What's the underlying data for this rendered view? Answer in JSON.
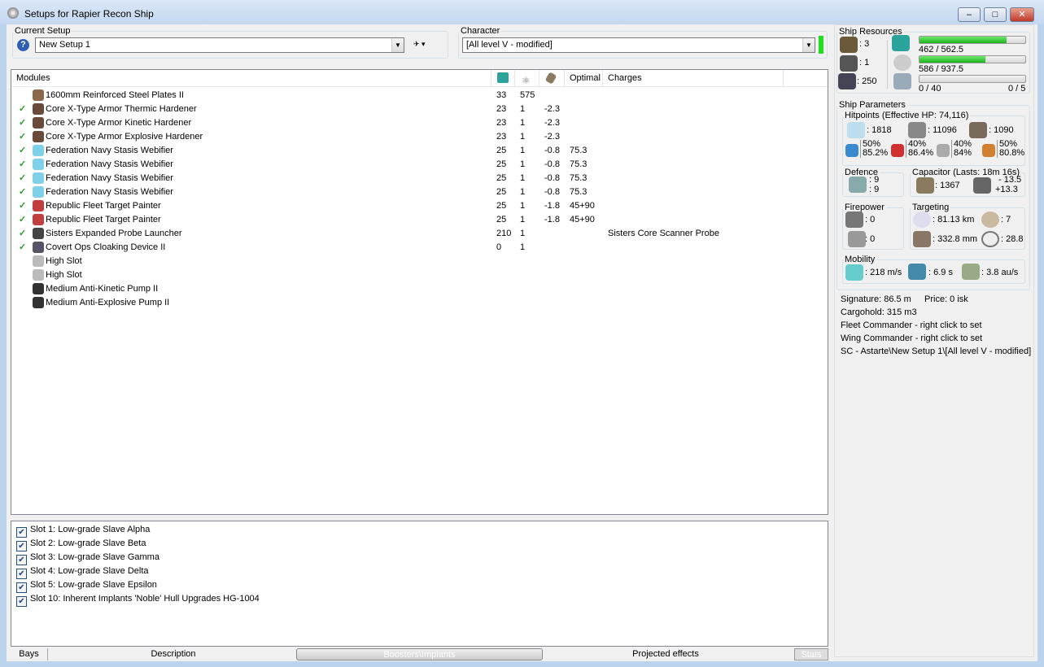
{
  "window": {
    "title": "Setups for Rapier Recon Ship",
    "min": "–",
    "max": "□",
    "close": "✕"
  },
  "current_setup": {
    "label": "Current Setup",
    "value": "New Setup 1"
  },
  "character": {
    "label": "Character",
    "value": "[All level V - modified]",
    "status_color": "#22dd22"
  },
  "modules": {
    "headers": [
      "Modules",
      "",
      "",
      "",
      "Optimal",
      "Charges"
    ],
    "rows": [
      {
        "check": "",
        "name": "1600mm Reinforced Steel Plates II",
        "c1": "33",
        "c2": "575",
        "c3": "",
        "optimal": "",
        "charges": "",
        "color": "#8a6a4a"
      },
      {
        "check": "✓",
        "name": "Core X-Type Armor Thermic Hardener",
        "c1": "23",
        "c2": "1",
        "c3": "-2.3",
        "optimal": "",
        "charges": "",
        "color": "#6a4a3a"
      },
      {
        "check": "✓",
        "name": "Core X-Type Armor Kinetic Hardener",
        "c1": "23",
        "c2": "1",
        "c3": "-2.3",
        "optimal": "",
        "charges": "",
        "color": "#6a4a3a"
      },
      {
        "check": "✓",
        "name": "Core X-Type Armor Explosive Hardener",
        "c1": "23",
        "c2": "1",
        "c3": "-2.3",
        "optimal": "",
        "charges": "",
        "color": "#6a4a3a"
      },
      {
        "check": "✓",
        "name": "Federation Navy Stasis Webifier",
        "c1": "25",
        "c2": "1",
        "c3": "-0.8",
        "optimal": "75.3",
        "charges": "",
        "color": "#7fd0e8"
      },
      {
        "check": "✓",
        "name": "Federation Navy Stasis Webifier",
        "c1": "25",
        "c2": "1",
        "c3": "-0.8",
        "optimal": "75.3",
        "charges": "",
        "color": "#7fd0e8"
      },
      {
        "check": "✓",
        "name": "Federation Navy Stasis Webifier",
        "c1": "25",
        "c2": "1",
        "c3": "-0.8",
        "optimal": "75.3",
        "charges": "",
        "color": "#7fd0e8"
      },
      {
        "check": "✓",
        "name": "Federation Navy Stasis Webifier",
        "c1": "25",
        "c2": "1",
        "c3": "-0.8",
        "optimal": "75.3",
        "charges": "",
        "color": "#7fd0e8"
      },
      {
        "check": "✓",
        "name": "Republic Fleet Target Painter",
        "c1": "25",
        "c2": "1",
        "c3": "-1.8",
        "optimal": "45+90",
        "charges": "",
        "color": "#c04040"
      },
      {
        "check": "✓",
        "name": "Republic Fleet Target Painter",
        "c1": "25",
        "c2": "1",
        "c3": "-1.8",
        "optimal": "45+90",
        "charges": "",
        "color": "#c04040"
      },
      {
        "check": "✓",
        "name": "Sisters Expanded Probe Launcher",
        "c1": "210",
        "c2": "1",
        "c3": "",
        "optimal": "",
        "charges": "Sisters Core Scanner Probe",
        "color": "#444"
      },
      {
        "check": "✓",
        "name": "Covert Ops Cloaking Device II",
        "c1": "0",
        "c2": "1",
        "c3": "",
        "optimal": "",
        "charges": "",
        "color": "#556"
      },
      {
        "check": "",
        "name": "High Slot",
        "c1": "",
        "c2": "",
        "c3": "",
        "optimal": "",
        "charges": "",
        "color": "#bbb"
      },
      {
        "check": "",
        "name": "High Slot",
        "c1": "",
        "c2": "",
        "c3": "",
        "optimal": "",
        "charges": "",
        "color": "#bbb"
      },
      {
        "check": "",
        "name": "Medium Anti-Kinetic Pump II",
        "c1": "",
        "c2": "",
        "c3": "",
        "optimal": "",
        "charges": "",
        "color": "#333"
      },
      {
        "check": "",
        "name": "Medium Anti-Explosive Pump II",
        "c1": "",
        "c2": "",
        "c3": "",
        "optimal": "",
        "charges": "",
        "color": "#333"
      }
    ]
  },
  "implants": [
    "Slot 1: Low-grade Slave Alpha",
    "Slot 2: Low-grade Slave Beta",
    "Slot 3: Low-grade Slave Gamma",
    "Slot 4: Low-grade Slave Delta",
    "Slot 5: Low-grade Slave Epsilon",
    "Slot 10: Inherent Implants 'Noble' Hull Upgrades HG-1004"
  ],
  "bottom_tabs": {
    "bays": "Bays",
    "description": "Description",
    "boosters": "Boosters\\Implants",
    "projected": "Projected effects",
    "stats": "Stats"
  },
  "resources": {
    "label": "Ship Resources",
    "turrets": ": 3",
    "launchers": ": 1",
    "drone_bay": ": 250",
    "cpu": {
      "text": "462 / 562.5",
      "fraction": 0.821
    },
    "power": {
      "text": "586 / 937.5",
      "fraction": 0.625
    },
    "calibration": {
      "text": "0 / 40",
      "fraction": 0
    },
    "rigs": "0 / 5"
  },
  "params": {
    "label": "Ship Parameters",
    "hitpoints": {
      "label": "Hitpoints (Effective HP: 74,116)",
      "shield": ": 1818",
      "armor": ": 11096",
      "structure": ": 1090",
      "resists": [
        {
          "a": "50%",
          "b": "85.2%",
          "color": "#3a8ad0"
        },
        {
          "a": "40%",
          "b": "86.4%",
          "color": "#d03030"
        },
        {
          "a": "40%",
          "b": "84%",
          "color": "#aaa"
        },
        {
          "a": "50%",
          "b": "80.8%",
          "color": "#d08030"
        }
      ]
    },
    "defence": {
      "label": "Defence",
      "a": ": 9",
      "b": ": 9"
    },
    "capacitor": {
      "label": "Capacitor (Lasts: 18m 16s)",
      "value": ": 1367",
      "a": "- 13.5",
      "b": "+13.3"
    },
    "firepower": {
      "label": "Firepower",
      "a": ": 0",
      "b": ": 0"
    },
    "targeting": {
      "label": "Targeting",
      "range": ": 81.13 km",
      "targets": ": 7",
      "sensor": ": 332.8 mm",
      "scan": ": 28.8"
    },
    "mobility": {
      "label": "Mobility",
      "speed": ": 218 m/s",
      "align": ": 6.9 s",
      "warp": ": 3.8 au/s"
    }
  },
  "info": [
    "Signature: 86.5 m",
    "Price: 0 isk",
    "Cargohold: 315 m3",
    "Fleet Commander - right click to set",
    "Wing Commander - right click to set",
    "SC - Astarte\\New Setup 1\\[All level V - modified]"
  ]
}
